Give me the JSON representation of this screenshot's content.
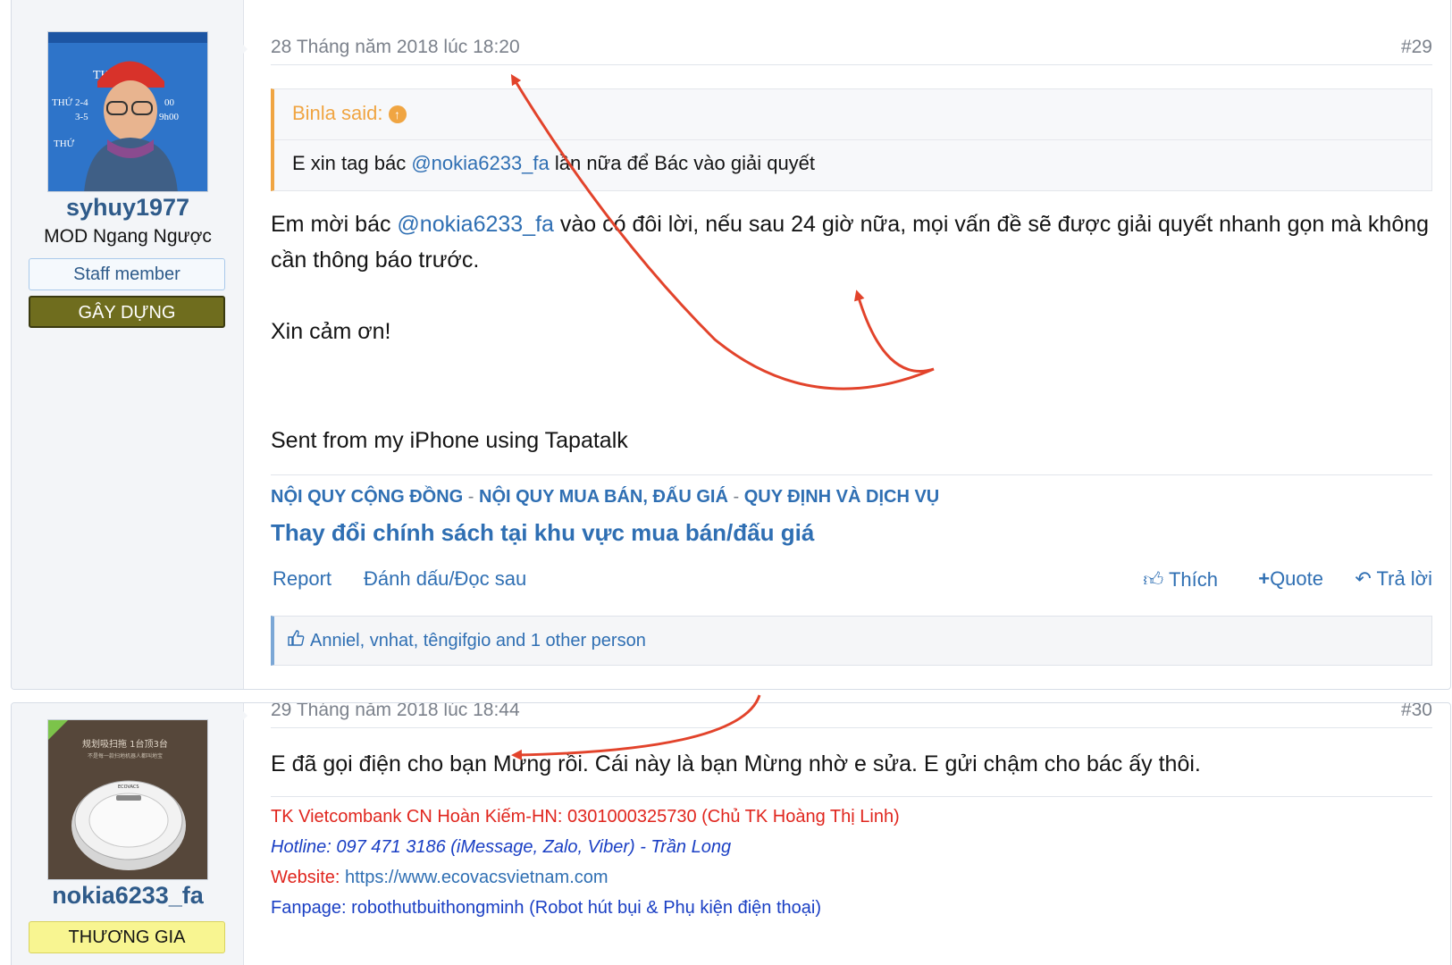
{
  "post1": {
    "username": "syhuy1977",
    "user_title": "MOD Ngang Ngược",
    "badge_staff": "Staff member",
    "badge_group": "GÂY DỰNG",
    "avatar_texts": [
      "THỨ 2-4",
      "3-5",
      "00",
      "9h00",
      "THỨ",
      "TH"
    ],
    "date": "28 Tháng năm 2018 lúc 18:20",
    "post_number": "#29",
    "quote_author": "Binla said:",
    "quote_text_before": "E xin tag bác ",
    "quote_mention": "@nokia6233_fa",
    "quote_text_after": " lần nữa để Bác vào giải quyết",
    "body_before": "Em mời bác ",
    "body_mention": "@nokia6233_fa",
    "body_after": " vào có đôi lời, nếu sau 24 giờ nữa, mọi vấn đề sẽ được giải quyết nhanh gọn mà không cần thông báo trước.",
    "body_thanks": "Xin cảm ơn!",
    "body_sent": "Sent from my iPhone using Tapatalk",
    "rule1": "NỘI QUY CỘNG ĐỒNG",
    "rule_sep": " - ",
    "rule2": "NỘI QUY MUA BÁN, ĐẤU GIÁ",
    "rule3": "QUY ĐỊNH VÀ DỊCH VỤ",
    "policy": "Thay đổi chính sách tại khu vực mua bán/đấu giá",
    "action_report": "Report",
    "action_bookmark": "Đánh dấu/Đọc sau",
    "action_like": "Thích",
    "action_quote": "Quote",
    "action_reply": "Trả lời",
    "likes_text": "Anniel, vnhat, têngifgio and 1 other person"
  },
  "post2": {
    "username": "nokia6233_fa",
    "badge_group": "THƯƠNG GIA",
    "avatar_texts": [
      "规划吸扫拖 1台顶3台",
      "不是每一款扫地机器人都叫地宝",
      "ECOVACS"
    ],
    "date": "29 Tháng năm 2018 lúc 18:44",
    "post_number": "#30",
    "body": "E đã gọi điện cho bạn Mừng rồi. Cái này là bạn Mừng nhờ e sửa. E gửi chậm cho bác ấy thôi.",
    "sig_bank": "TK Vietcombank CN Hoàn Kiếm-HN: 0301000325730 (Chủ TK Hoàng Thị Linh)",
    "sig_hotline": "Hotline: 097 471 3186 (iMessage, Zalo, Viber) - Trần Long",
    "sig_website_label": "Website: ",
    "sig_website_url": "https://www.ecovacsvietnam.com",
    "sig_fanpage": "Fanpage: robothutbuithongminh (Robot hút bụi & Phụ kiện điện thoại)"
  },
  "colors": {
    "link": "#2f6fb3",
    "username": "#2f5b8a",
    "quote_accent": "#f0a542",
    "annotation_arrow": "#e2432b"
  }
}
